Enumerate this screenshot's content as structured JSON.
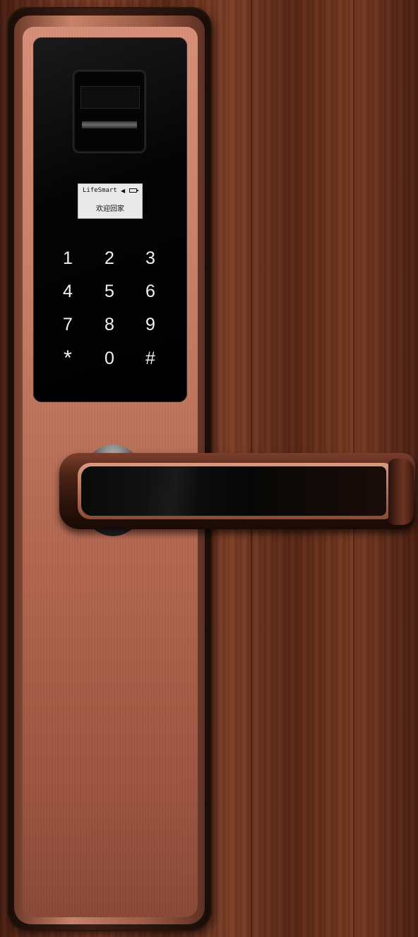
{
  "screen": {
    "brand": "LifeSmart",
    "message": "欢迎回家",
    "speaker_icon": "speaker-icon",
    "battery_icon": "battery-icon"
  },
  "keypad": {
    "keys": [
      "1",
      "2",
      "3",
      "4",
      "5",
      "6",
      "7",
      "8",
      "9",
      "*",
      "0",
      "#"
    ]
  },
  "colors": {
    "wood": "#6a3220",
    "copper": "#c57a62",
    "panel": "#000000",
    "key_text": "#f2f2f2",
    "screen_bg": "#e9e9e9"
  }
}
